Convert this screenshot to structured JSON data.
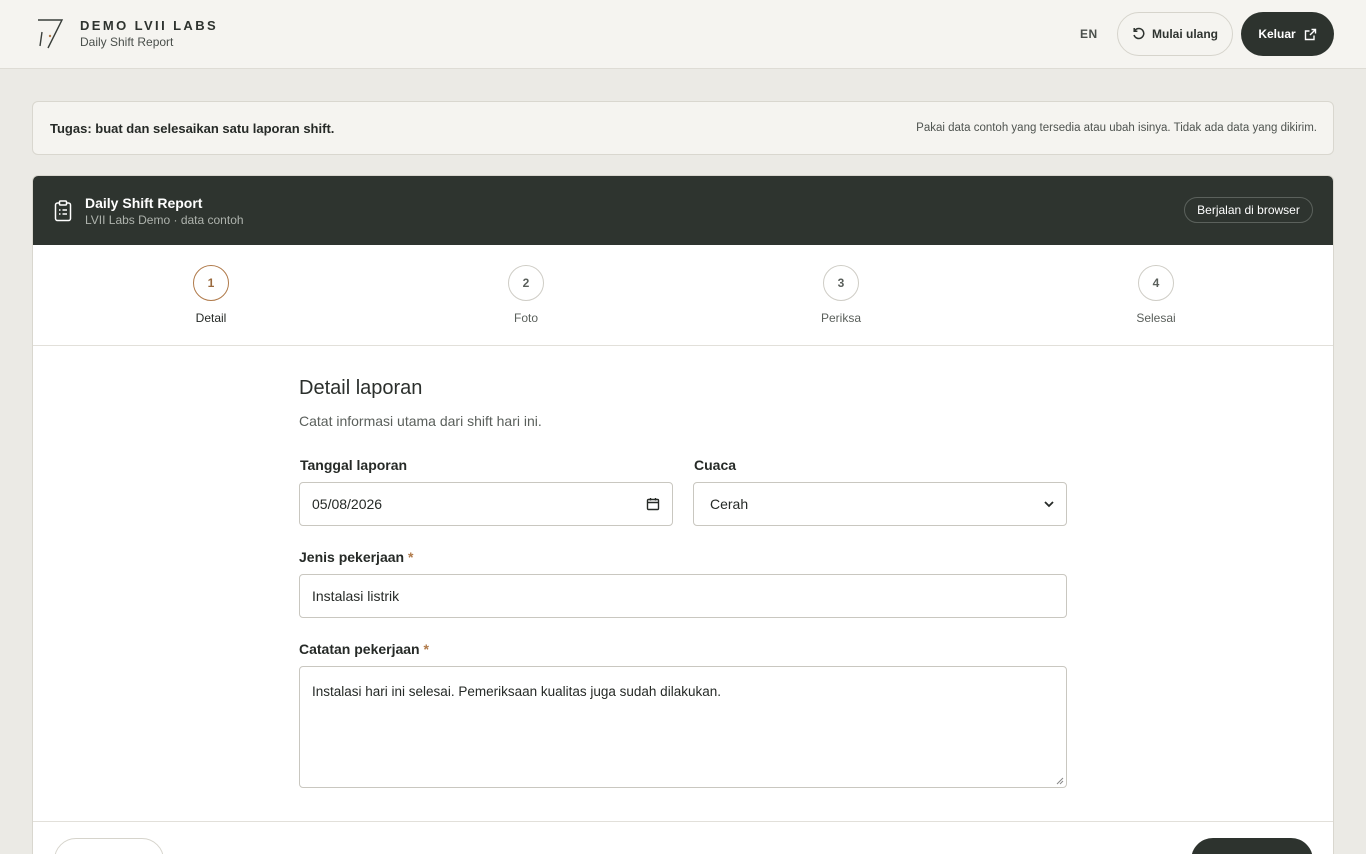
{
  "header": {
    "brand_name": "DEMO LVII LABS",
    "brand_sub": "Daily Shift Report",
    "lang": "EN",
    "restart_label": "Mulai ulang",
    "exit_label": "Keluar"
  },
  "task": {
    "title": "Tugas: buat dan selesaikan satu laporan shift.",
    "note": "Pakai data contoh yang tersedia atau ubah isinya. Tidak ada data yang dikirim."
  },
  "card": {
    "title": "Daily Shift Report",
    "subtitle": "LVII Labs Demo · data contoh",
    "badge": "Berjalan di browser"
  },
  "steps": [
    {
      "num": "1",
      "label": "Detail"
    },
    {
      "num": "2",
      "label": "Foto"
    },
    {
      "num": "3",
      "label": "Periksa"
    },
    {
      "num": "4",
      "label": "Selesai"
    }
  ],
  "form": {
    "title": "Detail laporan",
    "description": "Catat informasi utama dari shift hari ini.",
    "date_label": "Tanggal laporan",
    "date_value": "05/08/2026",
    "weather_label": "Cuaca",
    "weather_value": "Cerah",
    "job_label": "Jenis pekerjaan",
    "job_value": "Instalasi listrik",
    "notes_label": "Catatan pekerjaan",
    "notes_value": "Instalasi hari ini selesai. Pemeriksaan kualitas juga sudah dilakukan.",
    "required_mark": "*"
  },
  "colors": {
    "dark": "#2e342f",
    "accent": "#b07a4a",
    "background": "#ebeae5"
  }
}
